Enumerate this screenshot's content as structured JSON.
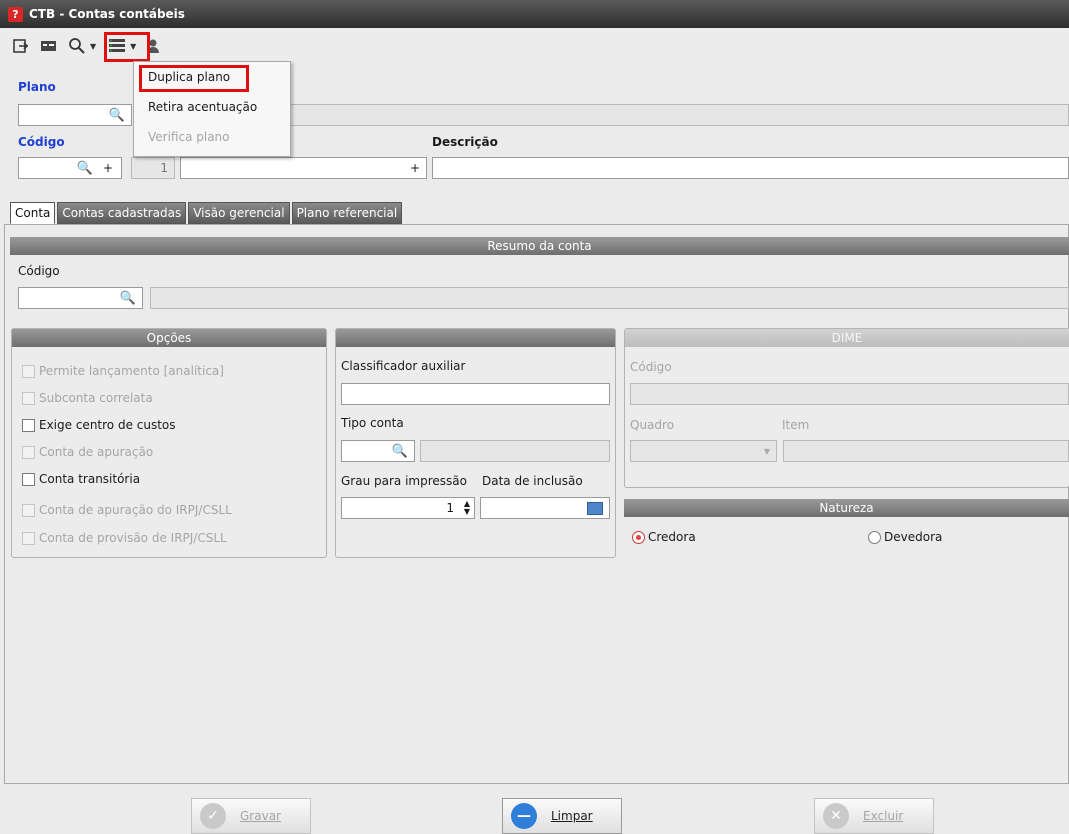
{
  "window": {
    "title": "CTB - Contas contábeis",
    "icon_glyph": "?"
  },
  "toolbar": {
    "icons": [
      "exit-icon",
      "card-icon",
      "search-icon",
      "list-icon",
      "user-icon"
    ]
  },
  "menu": {
    "items": [
      "Duplica plano",
      "Retira acentuação",
      "Verifica plano"
    ]
  },
  "header": {
    "plano_label": "Plano",
    "codigo_label": "Código",
    "descricao_label": "Descrição",
    "plus": "+",
    "sequence_value": "1"
  },
  "tabs": [
    "Conta",
    "Contas cadastradas",
    "Visão gerencial",
    "Plano referencial"
  ],
  "resumo": {
    "title": "Resumo da conta",
    "codigo_label": "Código"
  },
  "opcoes": {
    "title": "Opções",
    "items": [
      {
        "label": "Permite lançamento [analítica]",
        "enabled": false,
        "checked": false
      },
      {
        "label": "Subconta correlata",
        "enabled": false,
        "checked": false
      },
      {
        "label": "Exige centro de custos",
        "enabled": true,
        "checked": false
      },
      {
        "label": "Conta de apuração",
        "enabled": false,
        "checked": false
      },
      {
        "label": "Conta transitória",
        "enabled": true,
        "checked": false
      },
      {
        "label": "Conta de apuração do IRPJ/CSLL",
        "enabled": false,
        "checked": false
      },
      {
        "label": "Conta de provisão de IRPJ/CSLL",
        "enabled": false,
        "checked": false
      }
    ]
  },
  "middle": {
    "classificador_label": "Classificador auxiliar",
    "tipo_conta_label": "Tipo conta",
    "grau_label": "Grau para impressão",
    "grau_value": "1",
    "data_inclusao_label": "Data de inclusão"
  },
  "dime": {
    "title": "DIME",
    "codigo_label": "Código",
    "quadro_label": "Quadro",
    "item_label": "Item"
  },
  "natureza": {
    "title": "Natureza",
    "options": [
      "Credora",
      "Devedora"
    ],
    "selected": "Credora"
  },
  "actions": {
    "gravar": "Gravar",
    "limpar": "Limpar",
    "excluir": "Excluir"
  },
  "colors": {
    "highlight": "#e01010",
    "accent": "#1f3fd0"
  }
}
